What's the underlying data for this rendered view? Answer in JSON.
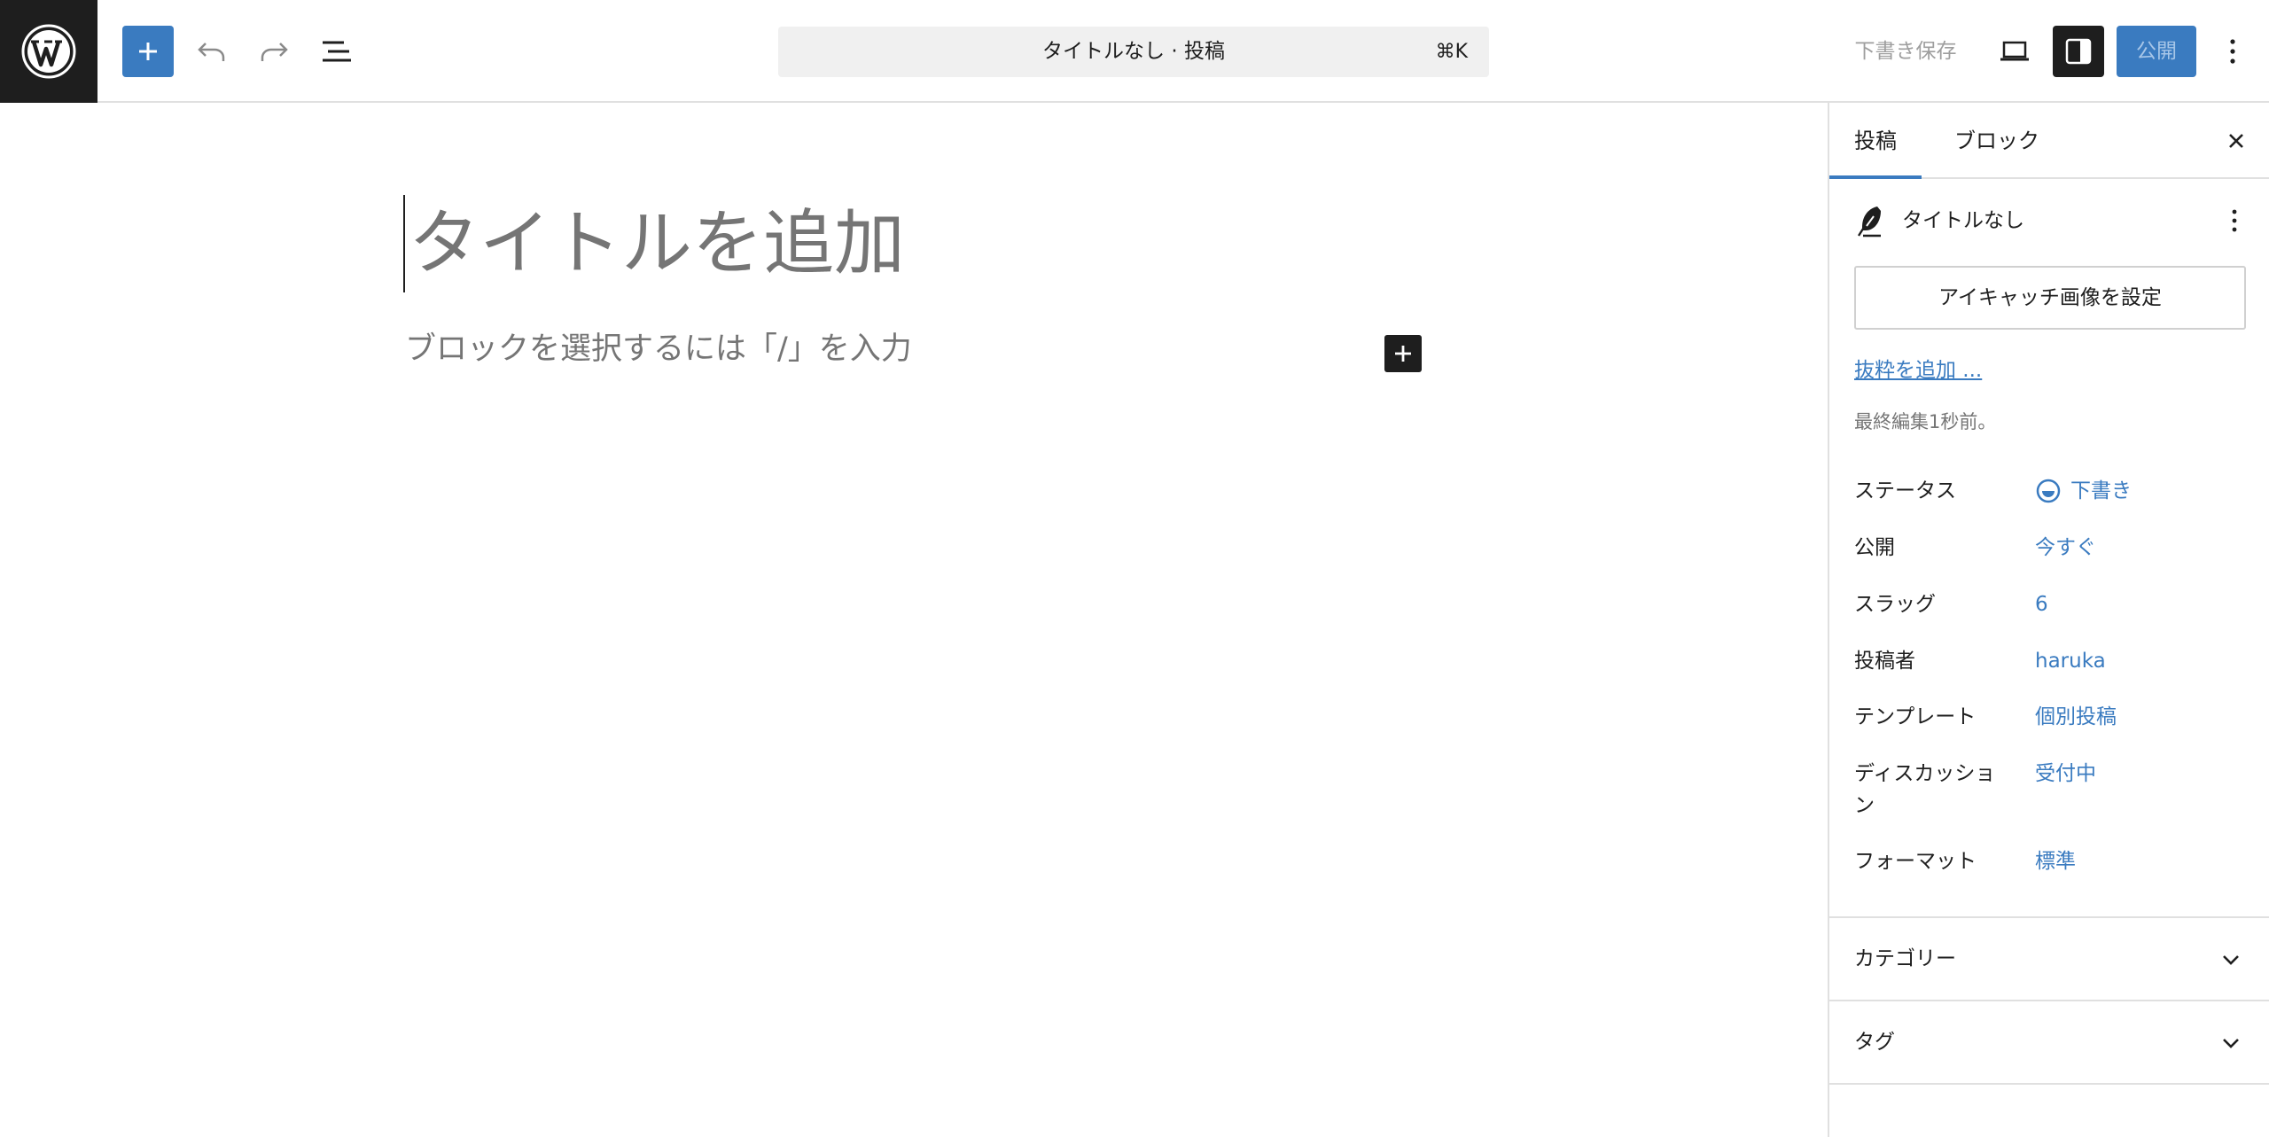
{
  "toolbar": {
    "document_title": "タイトルなし · 投稿",
    "shortcut": "⌘K",
    "save_draft": "下書き保存",
    "publish": "公開"
  },
  "editor": {
    "title_placeholder": "タイトルを追加",
    "block_placeholder": "ブロックを選択するには「/」を入力"
  },
  "sidebar": {
    "tabs": [
      "投稿",
      "ブロック"
    ],
    "summary_title": "タイトルなし",
    "featured_image_button": "アイキャッチ画像を設定",
    "excerpt_link": "抜粋を追加 ...",
    "last_edited": "最終編集1秒前。",
    "fields": [
      {
        "label": "ステータス",
        "value": "下書き"
      },
      {
        "label": "公開",
        "value": "今すぐ"
      },
      {
        "label": "スラッグ",
        "value": "6"
      },
      {
        "label": "投稿者",
        "value": "haruka"
      },
      {
        "label": "テンプレート",
        "value": "個別投稿"
      },
      {
        "label": "ディスカッション",
        "value": "受付中"
      },
      {
        "label": "フォーマット",
        "value": "標準"
      }
    ],
    "panels": [
      "カテゴリー",
      "タグ"
    ]
  },
  "colors": {
    "accent": "#3a7bc0",
    "dark": "#1e1e1e",
    "muted": "#757575"
  }
}
